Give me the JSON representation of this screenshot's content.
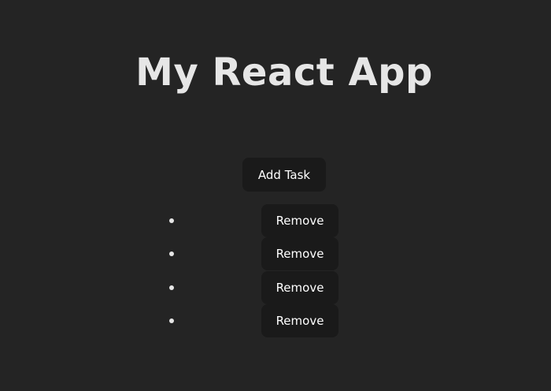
{
  "app": {
    "title": "My React App"
  },
  "controls": {
    "add_label": "Add Task"
  },
  "tasks": [
    {
      "text": "",
      "remove_label": "Remove"
    },
    {
      "text": "",
      "remove_label": "Remove"
    },
    {
      "text": "",
      "remove_label": "Remove"
    },
    {
      "text": "",
      "remove_label": "Remove"
    }
  ],
  "colors": {
    "background": "#242424",
    "button_bg": "#1a1a1a",
    "text": "#e6e6e6"
  }
}
